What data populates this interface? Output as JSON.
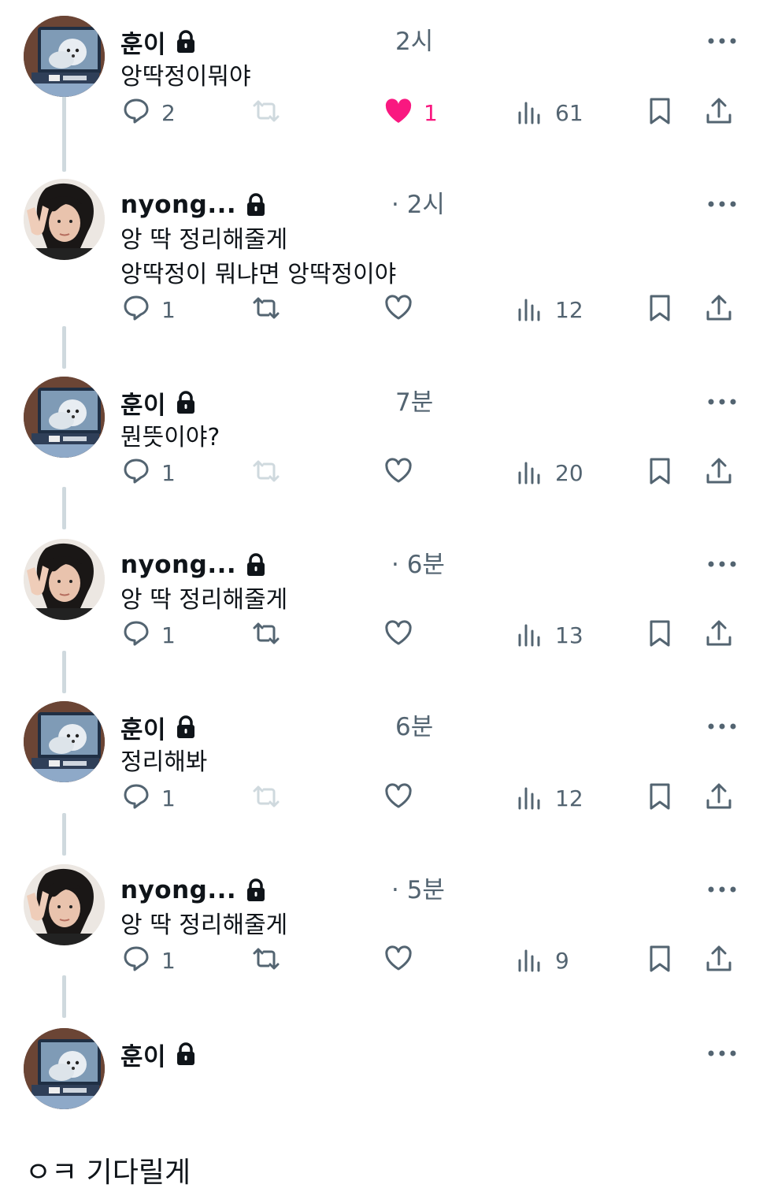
{
  "colors": {
    "like": "#f91880",
    "muted": "#536471",
    "disabled": "#cfd9de",
    "line": "#cfd9de"
  },
  "icons": {
    "reply": "reply-icon",
    "retweet": "retweet-icon",
    "like": "heart-icon",
    "views": "views-icon",
    "bookmark": "bookmark-icon",
    "share": "share-icon",
    "more": "more-icon",
    "lock": "lock-icon"
  },
  "tweets": [
    {
      "name": "훈이",
      "time": "2시",
      "text": "앙딱정이뭐야",
      "replies": "2",
      "likes": "1",
      "views": "61",
      "liked": true,
      "retweet_disabled": true,
      "avatar": "dog"
    },
    {
      "name": "nyong...",
      "time": "· 2시",
      "text": "앙 딱 정리해줄게\n앙딱정이 뭐냐면 앙딱정이야",
      "replies": "1",
      "likes": "",
      "views": "12",
      "liked": false,
      "retweet_disabled": false,
      "avatar": "person"
    },
    {
      "name": "훈이",
      "time": "7분",
      "text": "뭔뜻이야?",
      "replies": "1",
      "likes": "",
      "views": "20",
      "liked": false,
      "retweet_disabled": true,
      "avatar": "dog"
    },
    {
      "name": "nyong...",
      "time": "· 6분",
      "text": "앙 딱 정리해줄게",
      "replies": "1",
      "likes": "",
      "views": "13",
      "liked": false,
      "retweet_disabled": false,
      "avatar": "person"
    },
    {
      "name": "훈이",
      "time": "6분",
      "text": "정리해봐",
      "replies": "1",
      "likes": "",
      "views": "12",
      "liked": false,
      "retweet_disabled": true,
      "avatar": "dog"
    },
    {
      "name": "nyong...",
      "time": "· 5분",
      "text": "앙 딱 정리해줄게",
      "replies": "1",
      "likes": "",
      "views": "9",
      "liked": false,
      "retweet_disabled": false,
      "avatar": "person"
    },
    {
      "name": "훈이",
      "time": "",
      "text": "",
      "avatar": "dog",
      "no_actions": true
    }
  ],
  "caption": "ㅇㅋ 기다릴게"
}
